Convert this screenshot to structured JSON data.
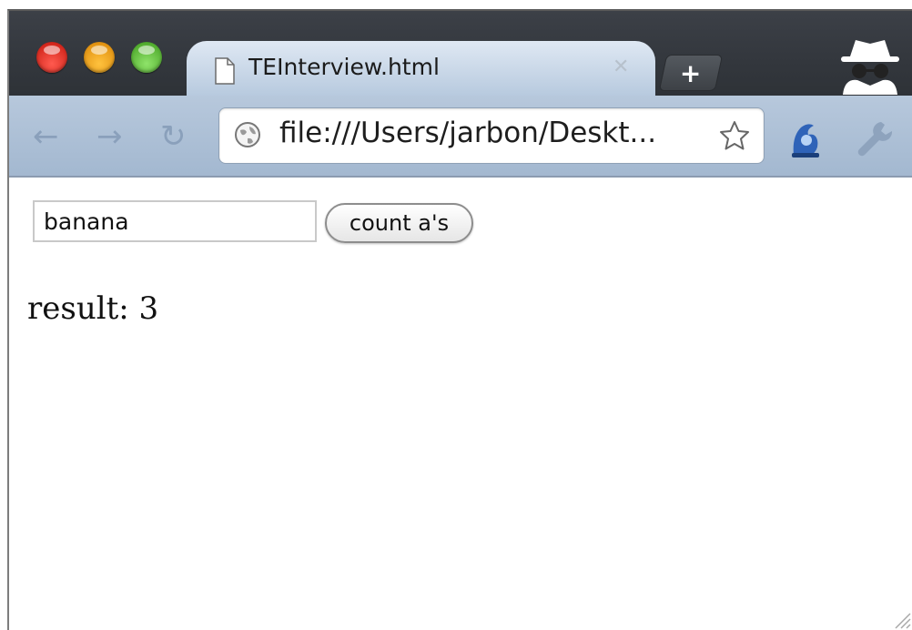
{
  "tab": {
    "title": "TEInterview.html",
    "close_glyph": "✕"
  },
  "new_tab": {
    "glyph": "+"
  },
  "toolbar": {
    "back_glyph": "←",
    "forward_glyph": "→",
    "reload_glyph": "↻",
    "url": "file:///Users/jarbon/Deskt..."
  },
  "page": {
    "input_value": "banana",
    "button_label": "count a's",
    "result_text": "result: 3"
  },
  "colors": {
    "tabstrip": "#33373d",
    "toolbar": "#a9bdd4",
    "tab_active": "#cfdceb"
  },
  "icons": [
    "document-icon",
    "globe-icon",
    "star-icon",
    "extension-icon",
    "wrench-icon",
    "incognito-icon"
  ]
}
